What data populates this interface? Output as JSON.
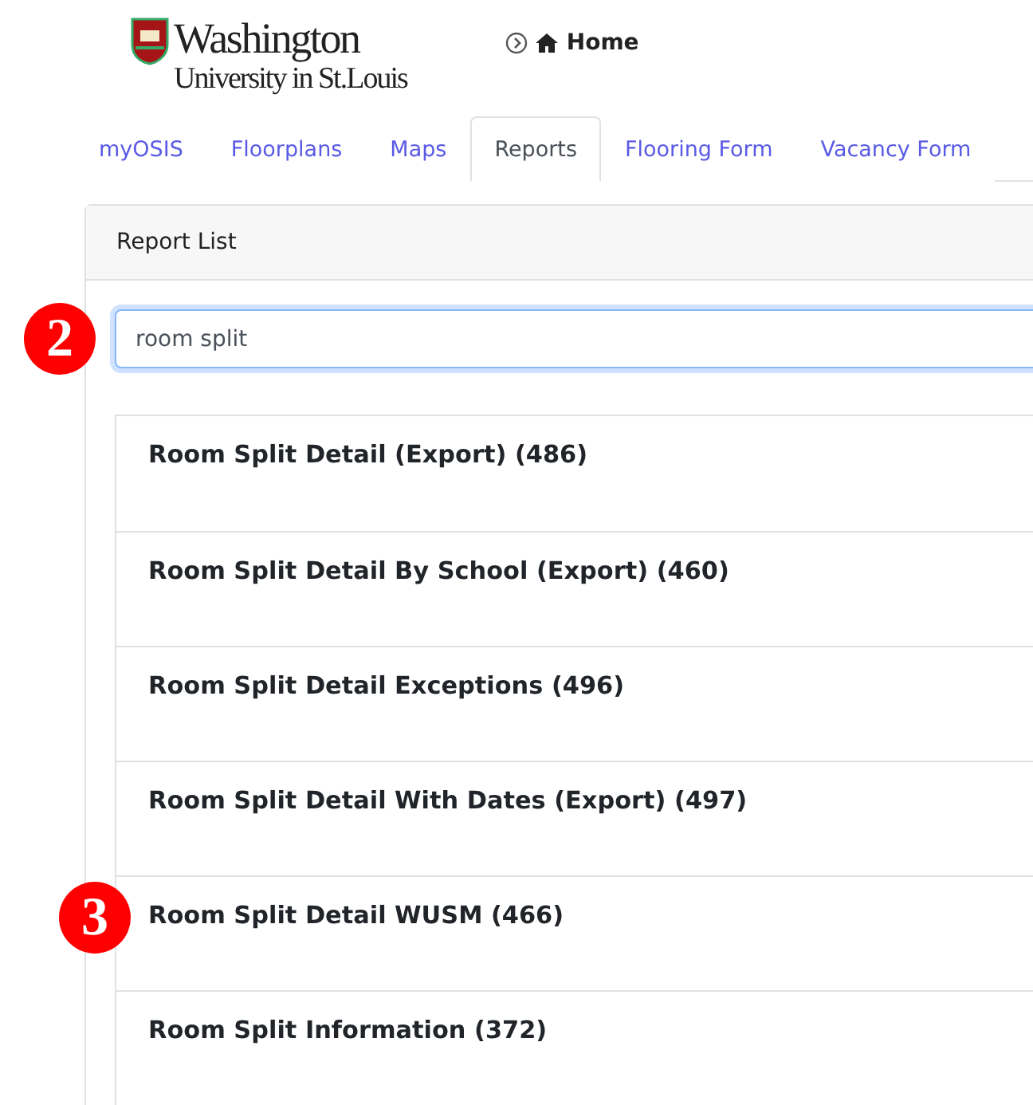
{
  "logo": {
    "line_1": "Washington",
    "line_2": "University in St.Louis"
  },
  "breadcrumb": {
    "label": "Home"
  },
  "tabs": [
    {
      "label": "myOSIS",
      "selected": false
    },
    {
      "label": "Floorplans",
      "selected": false
    },
    {
      "label": "Maps",
      "selected": false
    },
    {
      "label": "Reports",
      "selected": true
    },
    {
      "label": "Flooring Form",
      "selected": false
    },
    {
      "label": "Vacancy Form",
      "selected": false
    }
  ],
  "panel": {
    "title": "Report List",
    "search": {
      "value": "room split",
      "focused": true,
      "callout": "2"
    },
    "reports": [
      {
        "label": "Room Split Detail (Export) (486)"
      },
      {
        "label": "Room Split Detail By School (Export) (460)"
      },
      {
        "label": "Room Split Detail Exceptions (496)"
      },
      {
        "label": "Room Split Detail With Dates (Export) (497)"
      },
      {
        "label": "Room Split Detail WUSM (466)",
        "callout": "3"
      },
      {
        "label": "Room Split Information (372)"
      }
    ]
  }
}
